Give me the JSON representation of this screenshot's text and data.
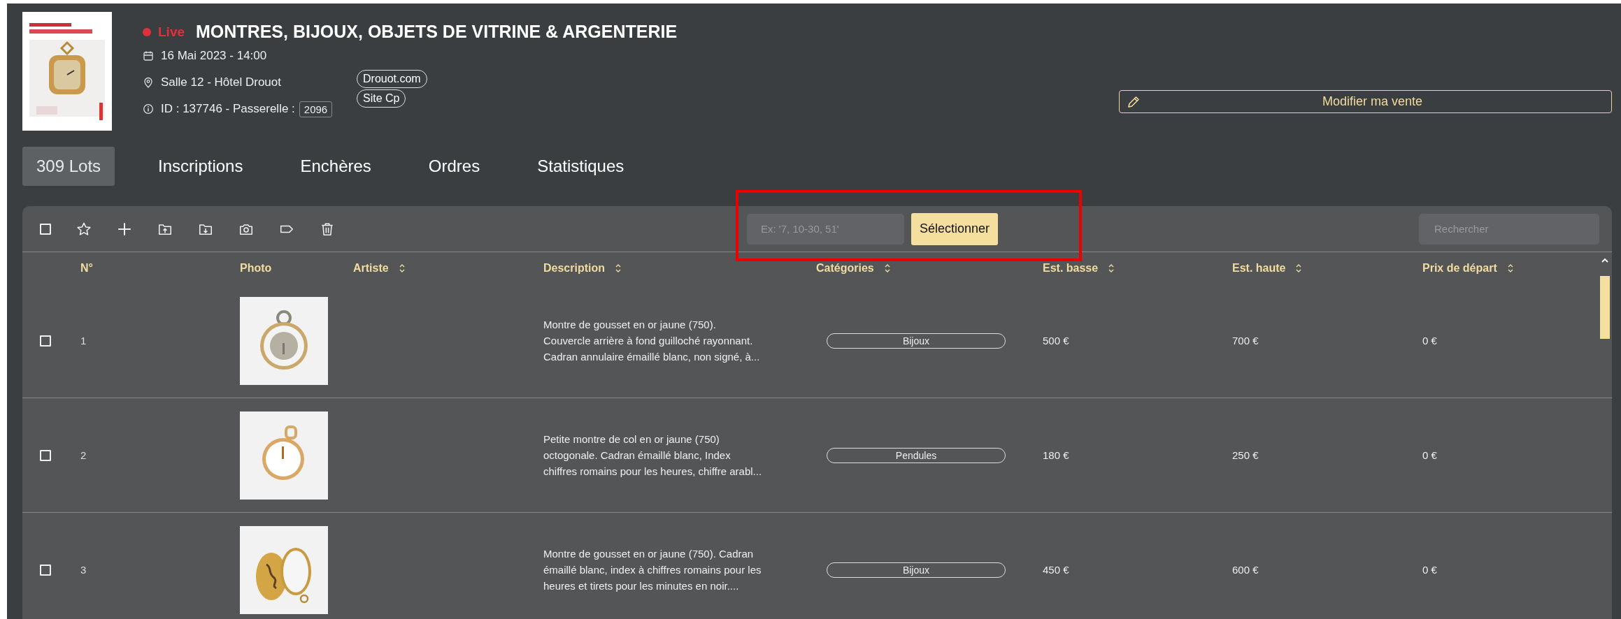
{
  "sale": {
    "live_label": "Live",
    "title": "MONTRES, BIJOUX, OBJETS DE VITRINE & ARGENTERIE",
    "date": "16 Mai 2023 - 14:00",
    "venue": "Salle 12 - Hôtel Drouot",
    "id_text": "ID : 137746 - Passerelle :",
    "passerelle": "2096",
    "links": [
      "Drouot.com",
      "Site Cp"
    ],
    "edit_button": "Modifier ma vente"
  },
  "tabs": [
    {
      "label": "309 Lots",
      "selected": true
    },
    {
      "label": "Inscriptions",
      "selected": false
    },
    {
      "label": "Enchères",
      "selected": false
    },
    {
      "label": "Ordres",
      "selected": false
    },
    {
      "label": "Statistiques",
      "selected": false
    }
  ],
  "toolbar": {
    "select_all_checked": false,
    "range_placeholder": "Ex: '7, 10-30, 51'",
    "select_button": "Sélectionner",
    "search_placeholder": "Rechercher"
  },
  "table": {
    "columns": [
      {
        "label": "N°",
        "sortable": false
      },
      {
        "label": "Photo",
        "sortable": false
      },
      {
        "label": "Artiste",
        "sortable": true
      },
      {
        "label": "Description",
        "sortable": true
      },
      {
        "label": "Catégories",
        "sortable": true
      },
      {
        "label": "Est. basse",
        "sortable": true
      },
      {
        "label": "Est. haute",
        "sortable": true
      },
      {
        "label": "Prix de départ",
        "sortable": true
      }
    ],
    "rows": [
      {
        "checked": false,
        "number": "1",
        "description": "Montre de gousset en or jaune (750). Couvercle arrière à fond guilloché rayonnant. Cadran annulaire émaillé blanc, non signé, à...",
        "category": "Bijoux",
        "est_low": "500 €",
        "est_high": "700 €",
        "start_price": "0 €"
      },
      {
        "checked": false,
        "number": "2",
        "description": "Petite montre de col en or jaune (750) octogonale. Cadran émaillé blanc, Index chiffres romains pour les heures, chiffre arabl...",
        "category": "Pendules",
        "est_low": "180 €",
        "est_high": "250 €",
        "start_price": "0 €"
      },
      {
        "checked": false,
        "number": "3",
        "description": "Montre de gousset en or jaune (750). Cadran émaillé blanc, index à chiffres romains pour les heures et tirets pour les minutes en noir....",
        "category": "Bijoux",
        "est_low": "450 €",
        "est_high": "600 €",
        "start_price": "0 €"
      }
    ]
  }
}
